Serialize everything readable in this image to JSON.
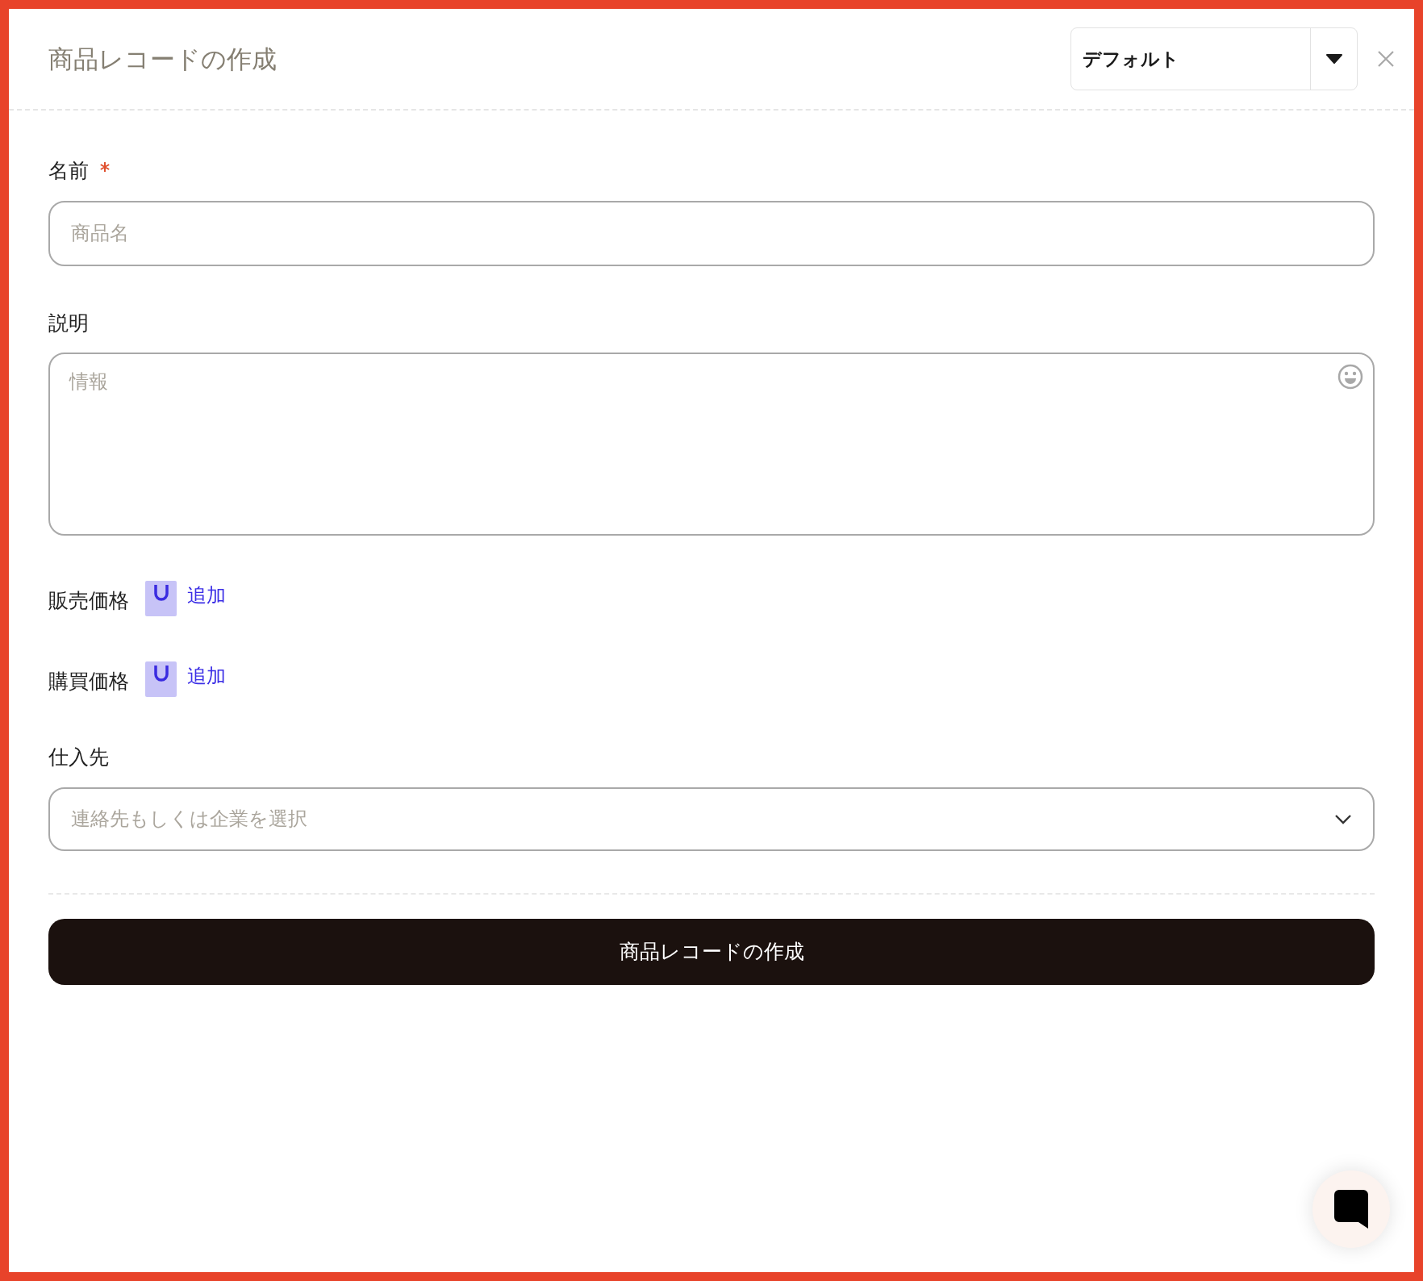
{
  "header": {
    "title": "商品レコードの作成",
    "view_select": {
      "value": "デフォルト"
    }
  },
  "fields": [
    {
      "kind": "text",
      "label": "名前",
      "required": true,
      "placeholder": "商品名"
    },
    {
      "kind": "textarea",
      "label": "説明",
      "required": false,
      "placeholder": "情報"
    },
    {
      "kind": "price",
      "label": "販売価格",
      "action": "追加"
    },
    {
      "kind": "price",
      "label": "購買価格",
      "action": "追加"
    },
    {
      "kind": "select",
      "label": "仕入先",
      "placeholder": "連絡先もしくは企業を選択"
    }
  ],
  "submit": "商品レコードの作成"
}
